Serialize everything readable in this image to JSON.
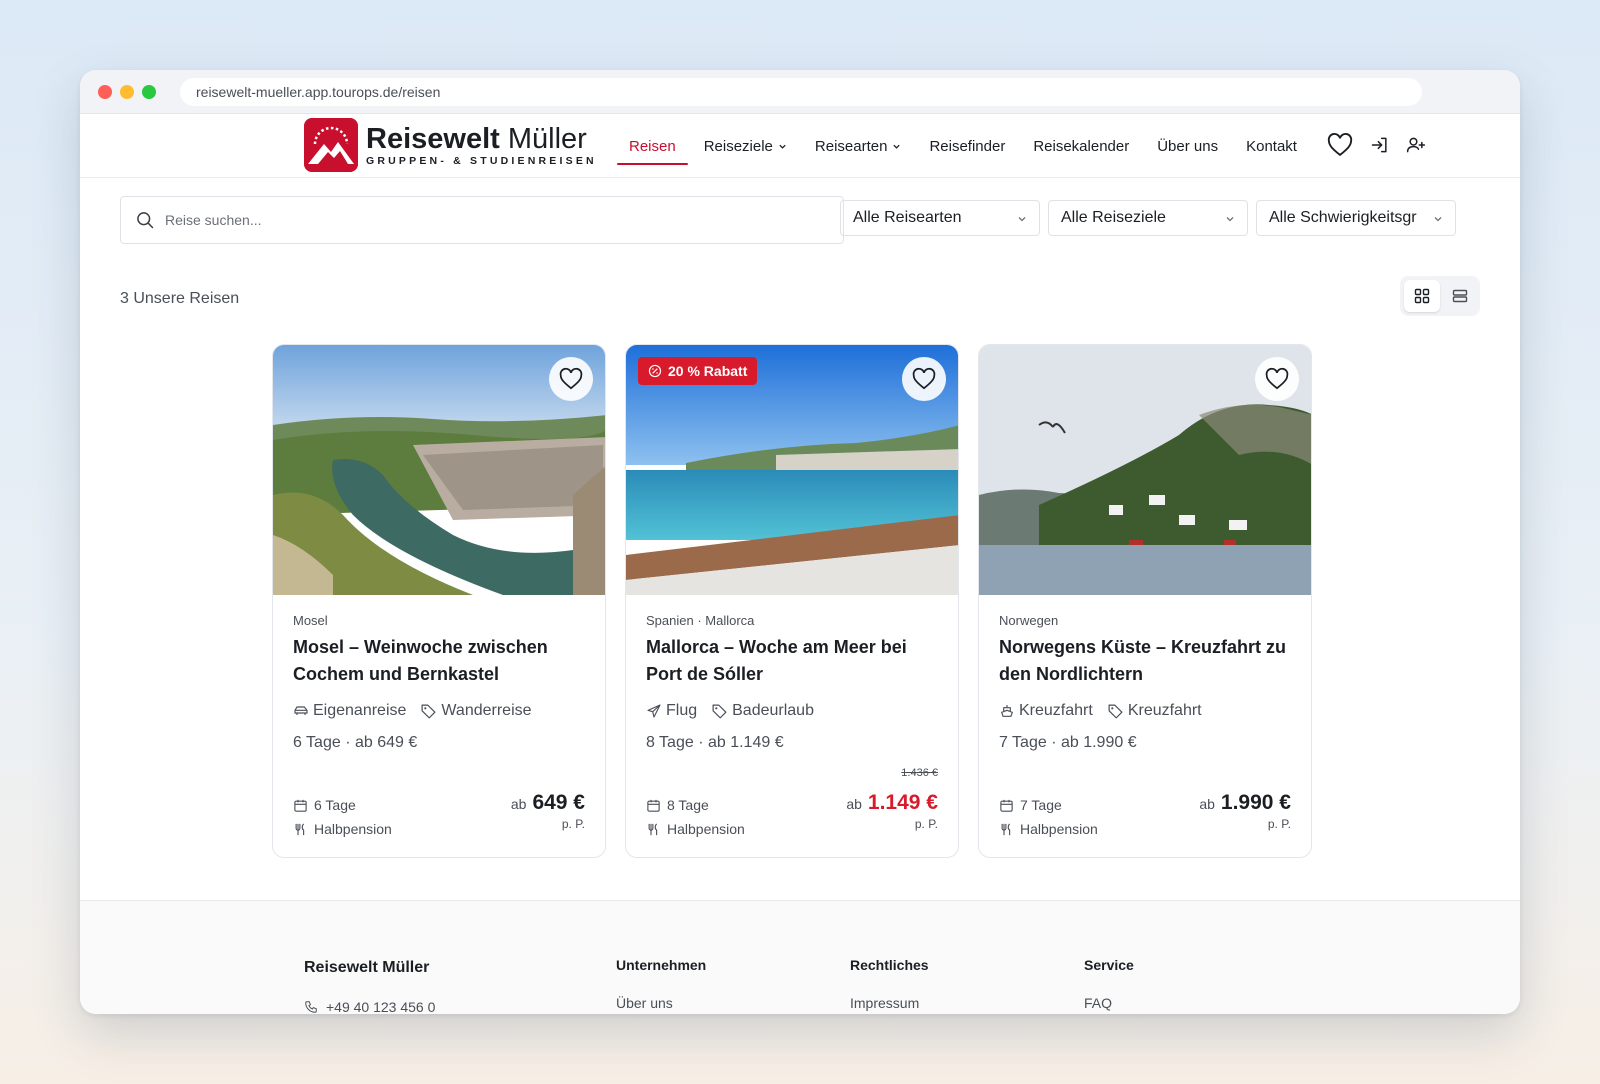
{
  "browser": {
    "url": "reisewelt-mueller.app.tourops.de/reisen"
  },
  "brand": {
    "name_bold": "Reisewelt",
    "name_light": "Müller",
    "tagline": "GRUPPEN- & STUDIENREISEN"
  },
  "nav": {
    "items": [
      {
        "label": "Reisen",
        "active": true
      },
      {
        "label": "Reiseziele",
        "dropdown": true
      },
      {
        "label": "Reisearten",
        "dropdown": true
      },
      {
        "label": "Reisefinder"
      },
      {
        "label": "Reisekalender"
      },
      {
        "label": "Über uns"
      },
      {
        "label": "Kontakt"
      }
    ],
    "icons": [
      "heart-icon",
      "login-icon",
      "user-plus-icon"
    ]
  },
  "filters": {
    "search_placeholder": "Reise suchen...",
    "type": "Alle Reisearten",
    "destination": "Alle Reiseziele",
    "difficulty": "Alle Schwierigkeitsgr"
  },
  "results": {
    "count_label": "3 Unsere Reisen"
  },
  "trips": [
    {
      "region": "Mosel",
      "title": "Mosel – Weinwoche zwischen Cochem und Bernkastel",
      "transport": "Eigenanreise",
      "category": "Wanderreise",
      "summary": "6 Tage · ab 649 €",
      "duration": "6 Tage",
      "board": "Halbpension",
      "price_prefix": "ab",
      "price": "649 €",
      "old_price": "",
      "per_person": "p. P.",
      "badge": ""
    },
    {
      "region": "Spanien · Mallorca",
      "title": "Mallorca – Woche am Meer bei Port de Sóller",
      "transport": "Flug",
      "category": "Badeurlaub",
      "summary": "8 Tage · ab 1.149 €",
      "duration": "8 Tage",
      "board": "Halbpension",
      "price_prefix": "ab",
      "price": "1.149 €",
      "old_price": "1.436 €",
      "per_person": "p. P.",
      "badge": "20 % Rabatt"
    },
    {
      "region": "Norwegen",
      "title": "Norwegens Küste – Kreuzfahrt zu den Nordlichtern",
      "transport": "Kreuzfahrt",
      "category": "Kreuzfahrt",
      "summary": "7 Tage · ab 1.990 €",
      "duration": "7 Tage",
      "board": "Halbpension",
      "price_prefix": "ab",
      "price": "1.990 €",
      "old_price": "",
      "per_person": "p. P.",
      "badge": ""
    }
  ],
  "footer": {
    "brand": "Reisewelt Müller",
    "phone": "+49 40 123 456 0",
    "columns": [
      {
        "heading": "Unternehmen",
        "first_link": "Über uns"
      },
      {
        "heading": "Rechtliches",
        "first_link": "Impressum"
      },
      {
        "heading": "Service",
        "first_link": "FAQ"
      }
    ]
  },
  "colors": {
    "brand_red": "#c8102e",
    "sale_red": "#d81b2c",
    "text": "#1b1f24",
    "muted": "#4a4f57"
  }
}
